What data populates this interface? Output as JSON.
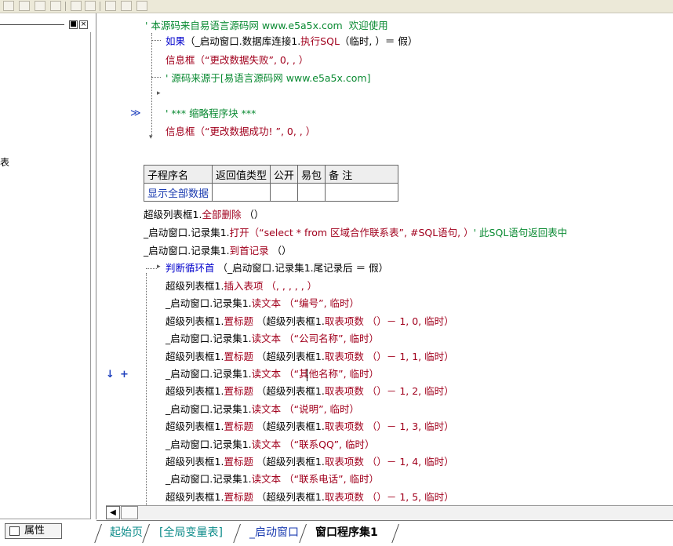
{
  "toolbar": {
    "icons": [
      "align-left-icon",
      "align-center-icon",
      "align-vertical-icon",
      "align-grid-icon",
      "distribute-h-icon",
      "distribute-v-icon",
      "same-width-icon",
      "same-height-icon",
      "same-size-icon"
    ]
  },
  "left_panel": {
    "partial_char": "表",
    "property_tab": "属性",
    "close_glyph": "×",
    "min_glyph": "■"
  },
  "gutter": {
    "bookmark": "≫",
    "down_arrow": "↓",
    "plus": "+"
  },
  "code": {
    "line1": "' 本源码来自易语言源码网 www.e5a5x.com  欢迎使用",
    "line2_kw": "如果",
    "line2_rest": "（_启动窗口.数据库连接1.",
    "line2_fn": "执行SQL",
    "line2_tail": "（临时, ）＝ 假）",
    "line3_fn": "信息框",
    "line3_str": "（“更改数据失败”, 0, , ）",
    "line4": "' 源码来源于[易语言源码网 www.e5a5x.com]",
    "line5": "' *** 缩略程序块 ***",
    "line6_fn": "信息框",
    "line6_str": "（“更改数据成功! ”, 0, , ）",
    "l7": "超级列表框1.",
    "l7_fn": "全部删除",
    "l7_tail": " （）",
    "l8_a": "_启动窗口.记录集1.",
    "l8_fn": "打开",
    "l8_str": "（“select * from 区域合作联系表”, #SQL语句, ）",
    "l8_cmt": "' 此SQL语句返回表中",
    "l9_a": "_启动窗口.记录集1.",
    "l9_fn": "到首记录",
    "l9_tail": " （）",
    "l10_kw": "判断循环首",
    "l10_rest": " （_启动窗口.记录集1.尾记录后 ＝ 假）",
    "body": [
      {
        "a": "超级列表框1.",
        "fn": "插入表项",
        "b": " （, , , , , ）"
      },
      {
        "a": "_启动窗口.记录集1.",
        "fn": "读文本",
        "b": " （“编号”, 临时）"
      },
      {
        "a": "超级列表框1.",
        "fn": "置标题",
        "b": " （超级列表框1.",
        "fn2": "取表项数",
        "c": " （）－ 1, 0, 临时）"
      },
      {
        "a": "_启动窗口.记录集1.",
        "fn": "读文本",
        "b": " （“公司名称”, 临时）"
      },
      {
        "a": "超级列表框1.",
        "fn": "置标题",
        "b": " （超级列表框1.",
        "fn2": "取表项数",
        "c": " （）－ 1, 1, 临时）"
      },
      {
        "a": "_启动窗口.记录集1.",
        "fn": "读文本",
        "b": " （“其他名称”, 临时）"
      },
      {
        "a": "超级列表框1.",
        "fn": "置标题",
        "b": " （超级列表框1.",
        "fn2": "取表项数",
        "c": " （）－ 1, 2, 临时）"
      },
      {
        "a": "_启动窗口.记录集1.",
        "fn": "读文本",
        "b": " （“说明”, 临时）"
      },
      {
        "a": "超级列表框1.",
        "fn": "置标题",
        "b": " （超级列表框1.",
        "fn2": "取表项数",
        "c": " （）－ 1, 3, 临时）"
      },
      {
        "a": "_启动窗口.记录集1.",
        "fn": "读文本",
        "b": " （“联系QQ”, 临时）"
      },
      {
        "a": "超级列表框1.",
        "fn": "置标题",
        "b": " （超级列表框1.",
        "fn2": "取表项数",
        "c": " （）－ 1, 4, 临时）"
      },
      {
        "a": "_启动窗口.记录集1.",
        "fn": "读文本",
        "b": " （“联系电话”, 临时）"
      },
      {
        "a": "超级列表框1.",
        "fn": "置标题",
        "b": " （超级列表框1.",
        "fn2": "取表项数",
        "c": " （）－ 1, 5, 临时）"
      }
    ]
  },
  "sub_table": {
    "headers": [
      "子程序名",
      "返回值类型",
      "公开",
      "易包",
      "备 注"
    ],
    "row": [
      "显示全部数据",
      "",
      "",
      "",
      ""
    ]
  },
  "tabs": [
    "起始页",
    "[全局变量表]",
    "_启动窗口",
    "窗口程序集1"
  ],
  "scroll": {
    "left_glyph": "◀"
  }
}
